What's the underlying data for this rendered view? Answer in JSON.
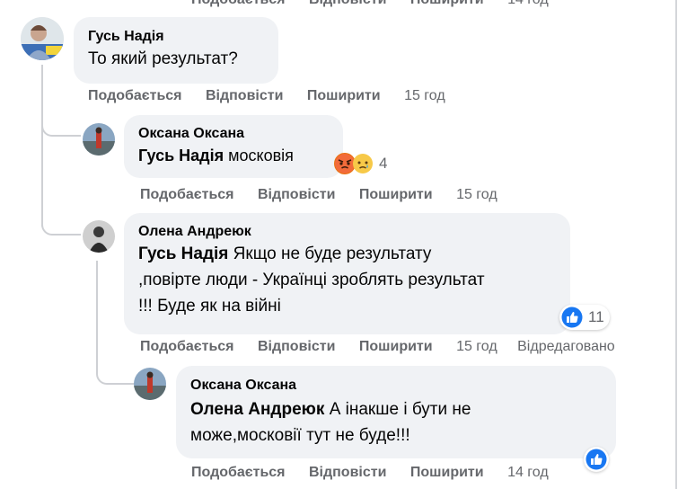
{
  "top_actions": {
    "like": "Подобається",
    "reply": "Відповісти",
    "share": "Поширити",
    "time": "14 год"
  },
  "comments": [
    {
      "author": "Гусь Надія",
      "mention": "",
      "text": "То який результат?",
      "actions": {
        "like": "Подобається",
        "reply": "Відповісти",
        "share": "Поширити",
        "time": "15 год",
        "edited": ""
      }
    },
    {
      "author": "Оксана Оксана",
      "mention": "Гусь Надія",
      "text": "московія",
      "reactions": {
        "icons": [
          "angry-emoji",
          "sad-emoji"
        ],
        "count": "4"
      },
      "actions": {
        "like": "Подобається",
        "reply": "Відповісти",
        "share": "Поширити",
        "time": "15 год",
        "edited": ""
      }
    },
    {
      "author": "Олена Андреюк",
      "mention": "Гусь Надія",
      "text_line1": "Якщо не буде результату",
      "text_line2": ",повірте люди - Українці зроблять результат",
      "text_line3": "!!! Буде як на війні",
      "reactions": {
        "icons": [
          "like-emoji"
        ],
        "count": "11"
      },
      "actions": {
        "like": "Подобається",
        "reply": "Відповісти",
        "share": "Поширити",
        "time": "15 год",
        "edited": "Відредаговано"
      }
    },
    {
      "author": "Оксана Оксана",
      "mention": "Олена Андреюк",
      "text_line1": "А інакше і бути не",
      "text_line2": "може,московії тут не буде!!!",
      "reactions": {
        "icons": [
          "like-emoji"
        ],
        "count": ""
      },
      "actions": {
        "like": "Подобається",
        "reply": "Відповісти",
        "share": "Поширити",
        "time": "14 год",
        "edited": ""
      }
    }
  ],
  "colors": {
    "bubble": "#f0f2f5",
    "meta": "#65676b",
    "like_blue": "#1877f2",
    "line": "#ced0d4"
  }
}
